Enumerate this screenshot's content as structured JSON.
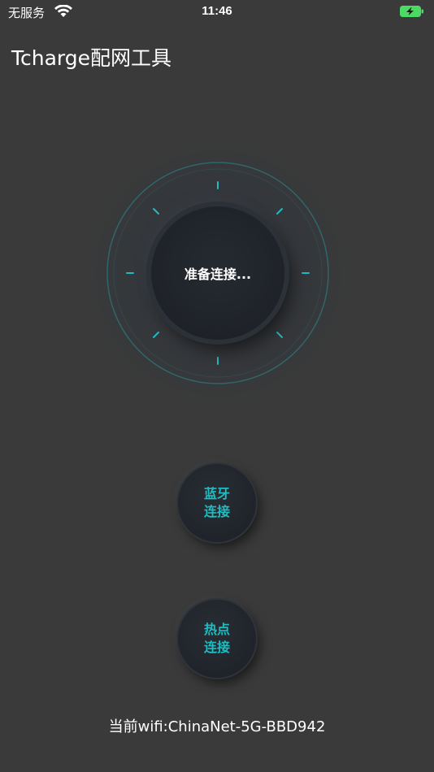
{
  "status_bar": {
    "carrier": "无服务",
    "time": "11:46",
    "wifi_icon": "wifi-icon",
    "battery_icon": "battery-charging-icon",
    "battery_color": "#4cd964"
  },
  "header": {
    "title": "Tcharge配网工具"
  },
  "dial": {
    "status": "准备连接...",
    "accent_color": "#1fbcc2"
  },
  "buttons": {
    "bluetooth": {
      "line1": "蓝牙",
      "line2": "连接"
    },
    "hotspot": {
      "line1": "热点",
      "line2": "连接"
    }
  },
  "footer": {
    "current_wifi": "当前wifi:ChinaNet-5G-BBD942"
  },
  "colors": {
    "background": "#3a3a3a",
    "accent": "#1fbcc2",
    "knob": "#20242a"
  }
}
